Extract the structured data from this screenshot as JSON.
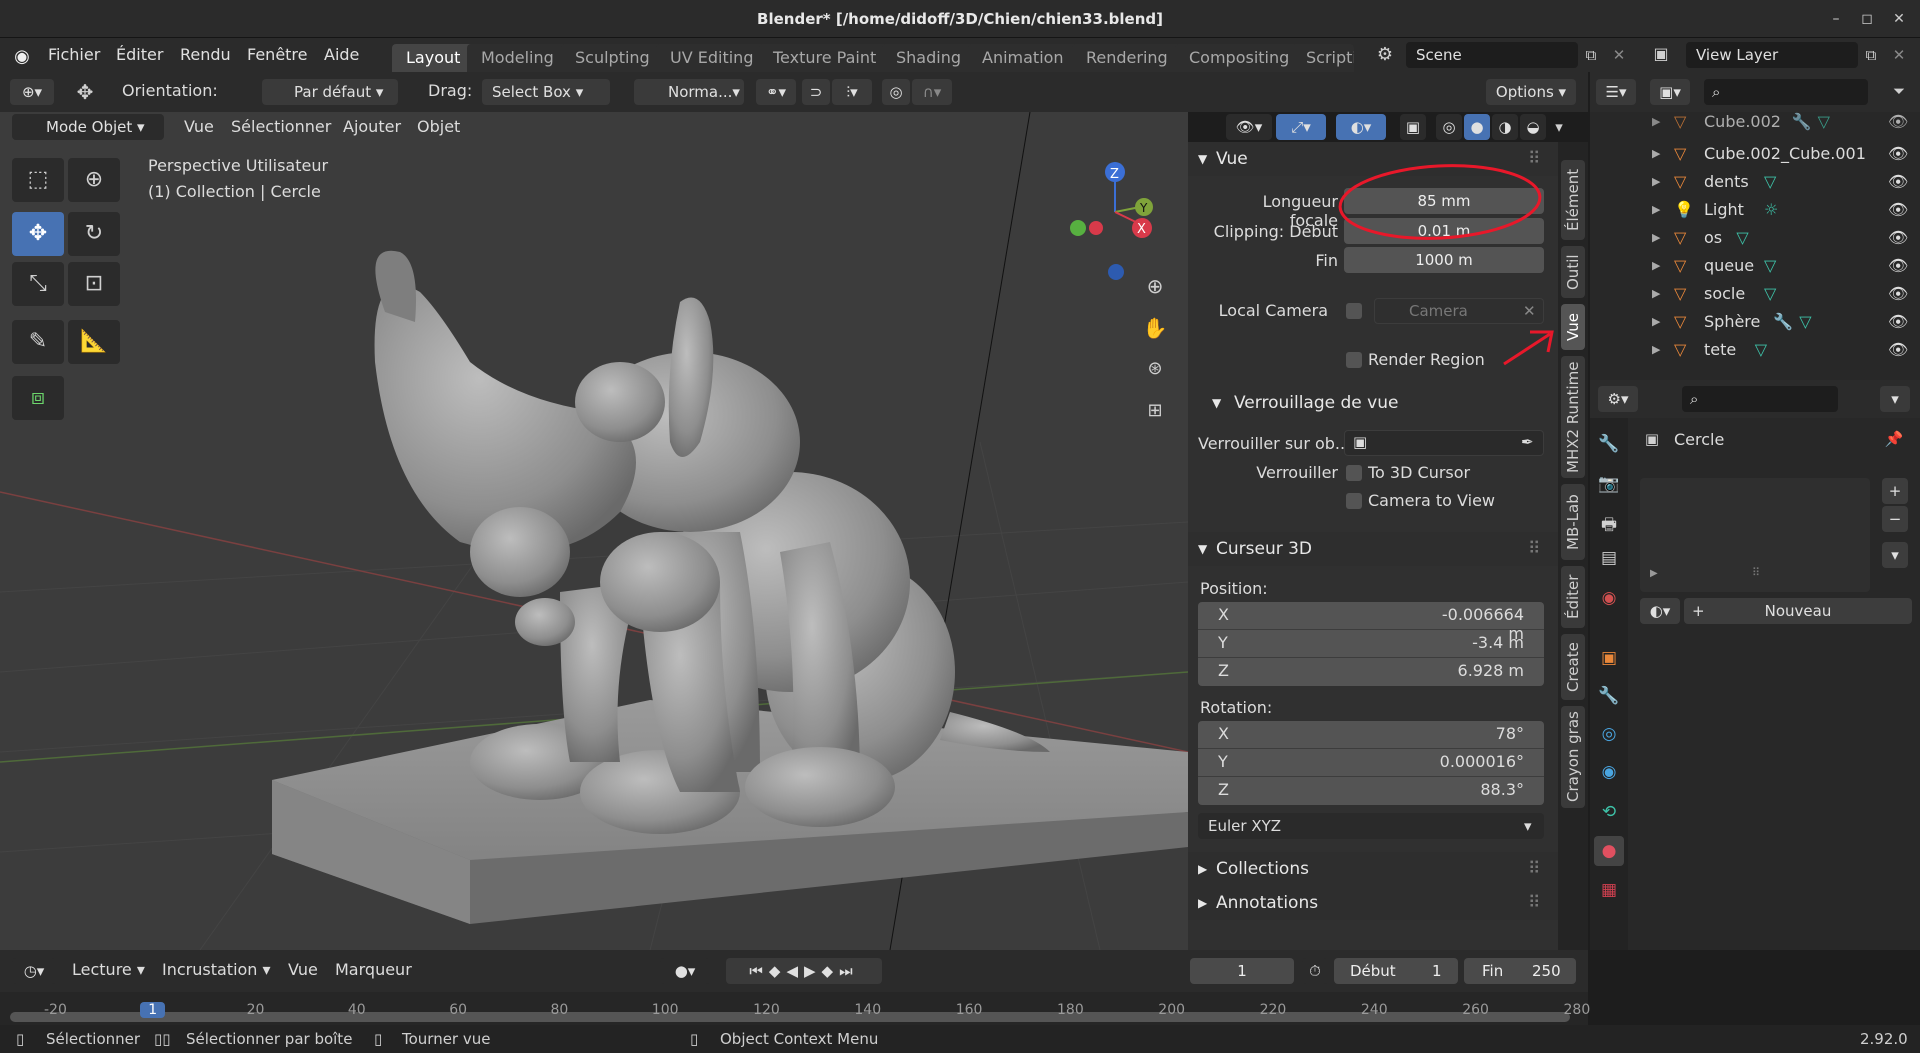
{
  "window": {
    "title": "Blender* [/home/didoff/3D/Chien/chien33.blend]",
    "minimize": "–",
    "maximize": "◻",
    "close": "✕"
  },
  "menus": [
    "Fichier",
    "Éditer",
    "Rendu",
    "Fenêtre",
    "Aide"
  ],
  "workspaces": [
    "Layout",
    "Modeling",
    "Sculpting",
    "UV Editing",
    "Texture Paint",
    "Shading",
    "Animation",
    "Rendering",
    "Compositing",
    "Scripti"
  ],
  "scene": {
    "name": "Scene",
    "view_layer": "View Layer"
  },
  "tool_header": {
    "orientation_label": "Orientation:",
    "orientation_value": "Par défaut",
    "drag_label": "Drag:",
    "drag_value": "Select Box",
    "pivot_value": "Norma...",
    "options": "Options"
  },
  "viewport_header": {
    "mode": "Mode Objet",
    "menus": [
      "Vue",
      "Sélectionner",
      "Ajouter",
      "Objet"
    ]
  },
  "viewport": {
    "view_name": "Perspective Utilisateur",
    "collection_info": "(1) Collection | Cercle"
  },
  "gizmo": {
    "z": "Z",
    "y": "Y",
    "x": "X"
  },
  "npanel": {
    "vue": {
      "title": "Vue",
      "focal_label": "Longueur focale",
      "focal_value": "85 mm",
      "clip_start_label": "Clipping: Début",
      "clip_start_value": "0.01 m",
      "clip_end_label": "Fin",
      "clip_end_value": "1000 m",
      "local_camera_label": "Local Camera",
      "camera_placeholder": "Camera",
      "render_region": "Render Region"
    },
    "verrouillage": {
      "title": "Verrouillage de vue",
      "lock_object_label": "Verrouiller sur ob...",
      "lock_label": "Verrouiller",
      "to_cursor": "To 3D Cursor",
      "camera_to_view": "Camera to View"
    },
    "curseur": {
      "title": "Curseur 3D",
      "position_label": "Position:",
      "px": "-0.006664 m",
      "py": "-3.4 m",
      "pz": "6.928 m",
      "rotation_label": "Rotation:",
      "rx": "78°",
      "ry": "0.000016°",
      "rz": "88.3°",
      "x": "X",
      "y": "Y",
      "z": "Z",
      "mode": "Euler XYZ"
    },
    "collections": "Collections",
    "annotations": "Annotations"
  },
  "vtabs": [
    "Élément",
    "Outil",
    "Vue",
    "MHX2 Runtime",
    "MB-Lab",
    "Éditer",
    "Create",
    "Crayon gras"
  ],
  "outliner": {
    "items": [
      "Cube.002",
      "Cube.002_Cube.001",
      "dents",
      "Light",
      "os",
      "queue",
      "socle",
      "Sphère",
      "tete"
    ]
  },
  "properties": {
    "object_name": "Cercle",
    "new_button": "Nouveau"
  },
  "timeline": {
    "menus": [
      "Lecture",
      "Incrustation",
      "Vue",
      "Marqueur"
    ],
    "current_frame": "1",
    "start_label": "Début",
    "start_value": "1",
    "end_label": "Fin",
    "end_value": "250",
    "ticks": [
      "-20",
      "1",
      "20",
      "40",
      "60",
      "80",
      "100",
      "120",
      "140",
      "160",
      "180",
      "200",
      "220",
      "240",
      "260",
      "280"
    ]
  },
  "status": {
    "select": "Sélectionner",
    "box_select": "Sélectionner par boîte",
    "rotate": "Tourner vue",
    "context": "Object Context Menu",
    "version": "2.92.0"
  },
  "colors": {
    "accent": "#4772b3",
    "annotation_red": "#e8182a",
    "outliner_mesh_icon": "#e8873a",
    "outliner_mod_icon": "#4aa5e0",
    "outliner_data_icon": "#3ec2a8"
  }
}
